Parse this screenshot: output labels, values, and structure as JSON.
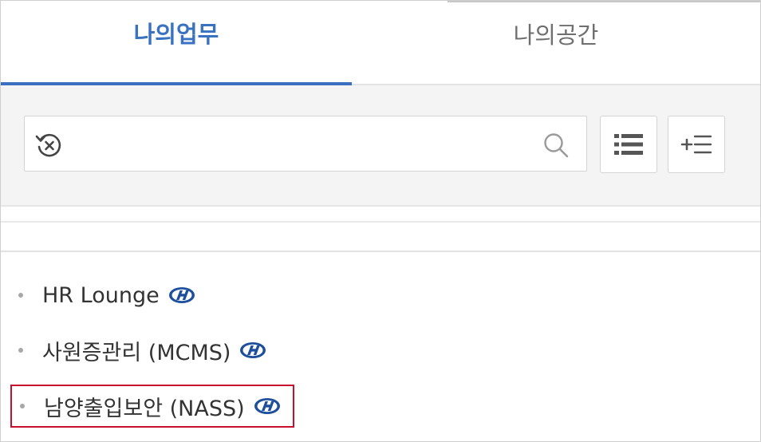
{
  "tabs": [
    {
      "label": "나의업무",
      "active": true
    },
    {
      "label": "나의공간",
      "active": false
    }
  ],
  "search": {
    "value": "",
    "placeholder": "",
    "reset_icon": "reset-history-icon",
    "search_icon": "search-icon"
  },
  "toolbar": {
    "list_icon": "list-icon",
    "add_icon": "add-list-icon",
    "add_label": "+☰"
  },
  "menu": {
    "items": [
      {
        "label": "HR Lounge",
        "icon": "hyundai-logo-icon"
      },
      {
        "label": "사원증관리 (MCMS)",
        "icon": "hyundai-logo-icon"
      },
      {
        "label": "남양출입보안 (NASS)",
        "icon": "hyundai-logo-icon",
        "highlighted": true
      }
    ]
  },
  "colors": {
    "accent": "#3d6fc0",
    "active_tab_text": "#3a72c2",
    "highlight_border": "#c8102e",
    "brand_logo": "#1e4f9c"
  }
}
